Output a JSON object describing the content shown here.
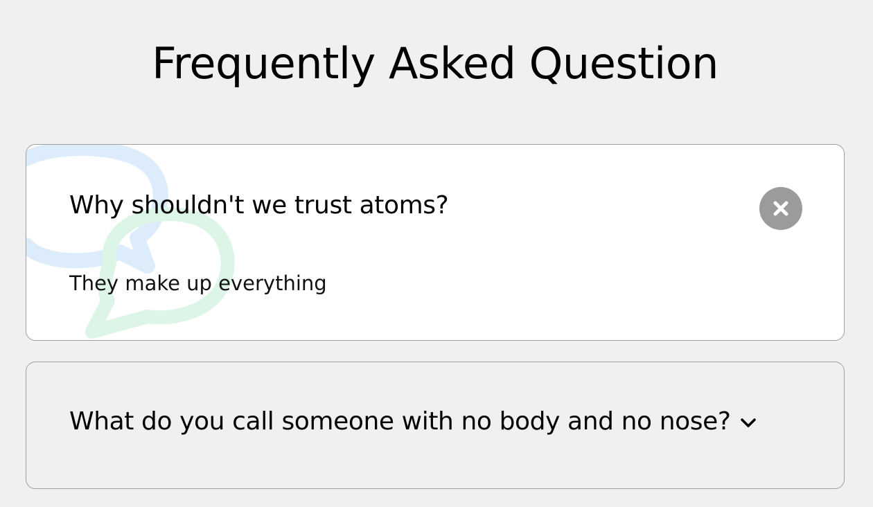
{
  "page": {
    "title": "Frequently Asked Question"
  },
  "faq": {
    "items": [
      {
        "question": "Why shouldn't we trust atoms?",
        "answer": "They make up everything",
        "state": "expanded",
        "toggle_icon": "close-icon"
      },
      {
        "question": "What do you call someone with no body and no nose?",
        "state": "collapsed",
        "toggle_icon": "chevron-down-icon"
      }
    ]
  },
  "colors": {
    "page_background": "#f0f0f0",
    "card_background": "#ffffff",
    "card_border": "#9e9e9e",
    "close_button": "#9b9b9b",
    "decor_blue": "#dcecfb",
    "decor_green": "#dcf5e6"
  }
}
